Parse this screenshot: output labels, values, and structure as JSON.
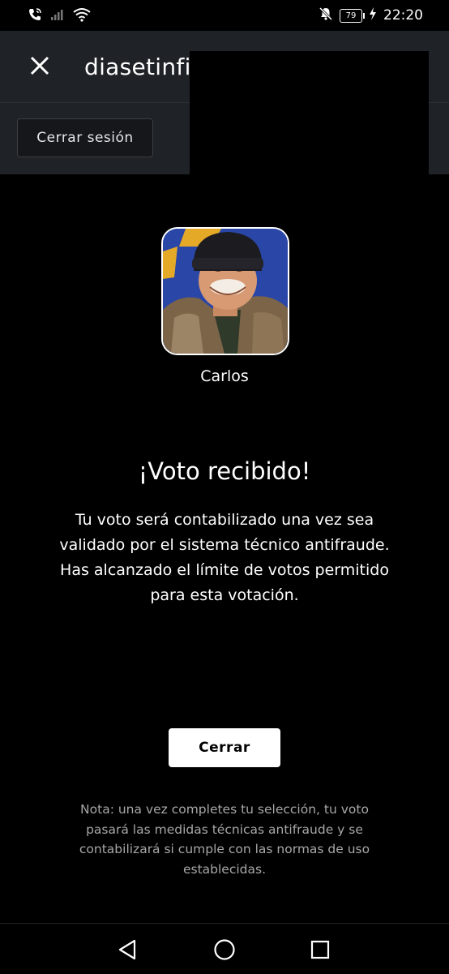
{
  "status_bar": {
    "time": "22:20",
    "battery": "79",
    "icons": [
      "call-wifi-icon",
      "signal-icon",
      "wifi-icon",
      "mute-icon",
      "battery-icon",
      "charging-icon"
    ]
  },
  "header": {
    "title_faded": "",
    "title": "diasetinfi",
    "logout_label": "Cerrar sesión"
  },
  "candidate": {
    "name": "Carlos"
  },
  "main": {
    "heading": "¡Voto recibido!",
    "message_lines": [
      "Tu voto será contabilizado una vez sea",
      "validado por el sistema técnico antifraude.",
      "Has alcanzado el límite de votos permitido",
      "para esta votación."
    ],
    "close_label": "Cerrar",
    "note_lines": [
      "Nota: una vez completes tu selección, tu voto",
      "pasará las medidas técnicas antifraude y se",
      "contabilizará si cumple con las normas de uso",
      "establecidas."
    ]
  },
  "colors": {
    "background": "#000000",
    "app_bar": "#1f2226",
    "button": "#ffffff",
    "note_text": "#a7a7a7"
  }
}
